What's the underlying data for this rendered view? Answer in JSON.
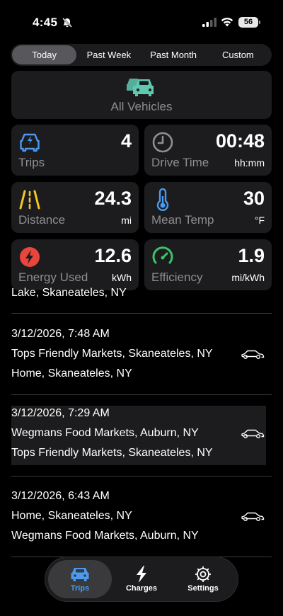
{
  "status_bar": {
    "time": "4:45",
    "battery": "56"
  },
  "range_tabs": [
    "Today",
    "Past Week",
    "Past Month",
    "Custom"
  ],
  "vehicles": {
    "label": "All Vehicles"
  },
  "stats": {
    "trips": {
      "label": "Trips",
      "value": "4",
      "unit": ""
    },
    "drive_time": {
      "label": "Drive Time",
      "value": "00:48",
      "unit": "hh:mm"
    },
    "distance": {
      "label": "Distance",
      "value": "24.3",
      "unit": "mi"
    },
    "mean_temp": {
      "label": "Mean Temp",
      "value": "30",
      "unit": "°F"
    },
    "energy_used": {
      "label": "Energy Used",
      "value": "12.6",
      "unit": "kWh"
    },
    "efficiency": {
      "label": "Efficiency",
      "value": "1.9",
      "unit": "mi/kWh"
    }
  },
  "trip_partial": "Lake, Skaneateles, NY",
  "trips": [
    {
      "datetime": "3/12/2026, 7:48 AM",
      "from": "Tops Friendly Markets, Skaneateles, NY",
      "to": "Home, Skaneateles, NY"
    },
    {
      "datetime": "3/12/2026, 7:29 AM",
      "from": "Wegmans Food Markets, Auburn, NY",
      "to": "Tops Friendly Markets, Skaneateles, NY"
    },
    {
      "datetime": "3/12/2026, 6:43 AM",
      "from": "Home, Skaneateles, NY",
      "to": "Wegmans Food Markets, Auburn, NY"
    }
  ],
  "tabbar": {
    "trips": "Trips",
    "charges": "Charges",
    "settings": "Settings"
  },
  "colors": {
    "accent": "#4a9bf0",
    "teal": "#5ec8b0",
    "yellow": "#f3c623",
    "red": "#e8453c",
    "green": "#3ac46a"
  }
}
